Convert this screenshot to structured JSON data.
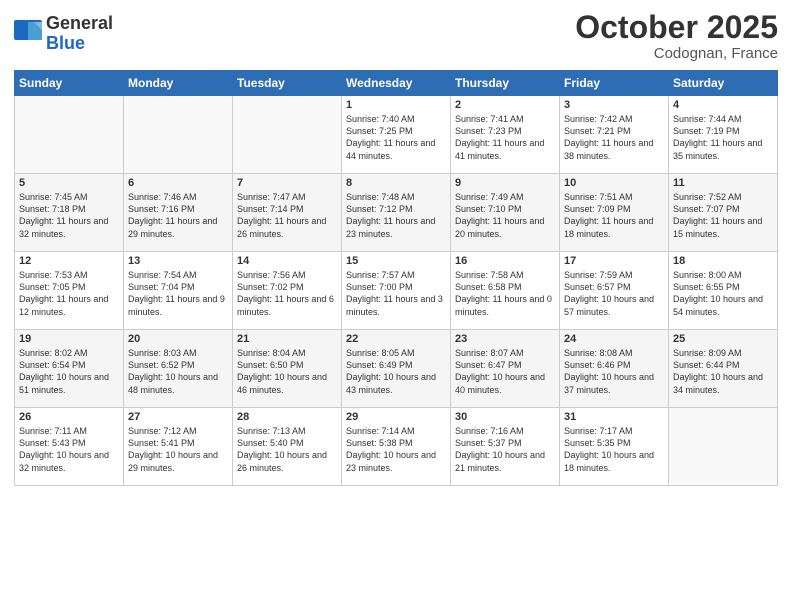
{
  "header": {
    "logo_general": "General",
    "logo_blue": "Blue",
    "month_title": "October 2025",
    "location": "Codognan, France"
  },
  "days_of_week": [
    "Sunday",
    "Monday",
    "Tuesday",
    "Wednesday",
    "Thursday",
    "Friday",
    "Saturday"
  ],
  "weeks": [
    [
      {
        "day": "",
        "info": ""
      },
      {
        "day": "",
        "info": ""
      },
      {
        "day": "",
        "info": ""
      },
      {
        "day": "1",
        "info": "Sunrise: 7:40 AM\nSunset: 7:25 PM\nDaylight: 11 hours and 44 minutes."
      },
      {
        "day": "2",
        "info": "Sunrise: 7:41 AM\nSunset: 7:23 PM\nDaylight: 11 hours and 41 minutes."
      },
      {
        "day": "3",
        "info": "Sunrise: 7:42 AM\nSunset: 7:21 PM\nDaylight: 11 hours and 38 minutes."
      },
      {
        "day": "4",
        "info": "Sunrise: 7:44 AM\nSunset: 7:19 PM\nDaylight: 11 hours and 35 minutes."
      }
    ],
    [
      {
        "day": "5",
        "info": "Sunrise: 7:45 AM\nSunset: 7:18 PM\nDaylight: 11 hours and 32 minutes."
      },
      {
        "day": "6",
        "info": "Sunrise: 7:46 AM\nSunset: 7:16 PM\nDaylight: 11 hours and 29 minutes."
      },
      {
        "day": "7",
        "info": "Sunrise: 7:47 AM\nSunset: 7:14 PM\nDaylight: 11 hours and 26 minutes."
      },
      {
        "day": "8",
        "info": "Sunrise: 7:48 AM\nSunset: 7:12 PM\nDaylight: 11 hours and 23 minutes."
      },
      {
        "day": "9",
        "info": "Sunrise: 7:49 AM\nSunset: 7:10 PM\nDaylight: 11 hours and 20 minutes."
      },
      {
        "day": "10",
        "info": "Sunrise: 7:51 AM\nSunset: 7:09 PM\nDaylight: 11 hours and 18 minutes."
      },
      {
        "day": "11",
        "info": "Sunrise: 7:52 AM\nSunset: 7:07 PM\nDaylight: 11 hours and 15 minutes."
      }
    ],
    [
      {
        "day": "12",
        "info": "Sunrise: 7:53 AM\nSunset: 7:05 PM\nDaylight: 11 hours and 12 minutes."
      },
      {
        "day": "13",
        "info": "Sunrise: 7:54 AM\nSunset: 7:04 PM\nDaylight: 11 hours and 9 minutes."
      },
      {
        "day": "14",
        "info": "Sunrise: 7:56 AM\nSunset: 7:02 PM\nDaylight: 11 hours and 6 minutes."
      },
      {
        "day": "15",
        "info": "Sunrise: 7:57 AM\nSunset: 7:00 PM\nDaylight: 11 hours and 3 minutes."
      },
      {
        "day": "16",
        "info": "Sunrise: 7:58 AM\nSunset: 6:58 PM\nDaylight: 11 hours and 0 minutes."
      },
      {
        "day": "17",
        "info": "Sunrise: 7:59 AM\nSunset: 6:57 PM\nDaylight: 10 hours and 57 minutes."
      },
      {
        "day": "18",
        "info": "Sunrise: 8:00 AM\nSunset: 6:55 PM\nDaylight: 10 hours and 54 minutes."
      }
    ],
    [
      {
        "day": "19",
        "info": "Sunrise: 8:02 AM\nSunset: 6:54 PM\nDaylight: 10 hours and 51 minutes."
      },
      {
        "day": "20",
        "info": "Sunrise: 8:03 AM\nSunset: 6:52 PM\nDaylight: 10 hours and 48 minutes."
      },
      {
        "day": "21",
        "info": "Sunrise: 8:04 AM\nSunset: 6:50 PM\nDaylight: 10 hours and 46 minutes."
      },
      {
        "day": "22",
        "info": "Sunrise: 8:05 AM\nSunset: 6:49 PM\nDaylight: 10 hours and 43 minutes."
      },
      {
        "day": "23",
        "info": "Sunrise: 8:07 AM\nSunset: 6:47 PM\nDaylight: 10 hours and 40 minutes."
      },
      {
        "day": "24",
        "info": "Sunrise: 8:08 AM\nSunset: 6:46 PM\nDaylight: 10 hours and 37 minutes."
      },
      {
        "day": "25",
        "info": "Sunrise: 8:09 AM\nSunset: 6:44 PM\nDaylight: 10 hours and 34 minutes."
      }
    ],
    [
      {
        "day": "26",
        "info": "Sunrise: 7:11 AM\nSunset: 5:43 PM\nDaylight: 10 hours and 32 minutes."
      },
      {
        "day": "27",
        "info": "Sunrise: 7:12 AM\nSunset: 5:41 PM\nDaylight: 10 hours and 29 minutes."
      },
      {
        "day": "28",
        "info": "Sunrise: 7:13 AM\nSunset: 5:40 PM\nDaylight: 10 hours and 26 minutes."
      },
      {
        "day": "29",
        "info": "Sunrise: 7:14 AM\nSunset: 5:38 PM\nDaylight: 10 hours and 23 minutes."
      },
      {
        "day": "30",
        "info": "Sunrise: 7:16 AM\nSunset: 5:37 PM\nDaylight: 10 hours and 21 minutes."
      },
      {
        "day": "31",
        "info": "Sunrise: 7:17 AM\nSunset: 5:35 PM\nDaylight: 10 hours and 18 minutes."
      },
      {
        "day": "",
        "info": ""
      }
    ]
  ]
}
